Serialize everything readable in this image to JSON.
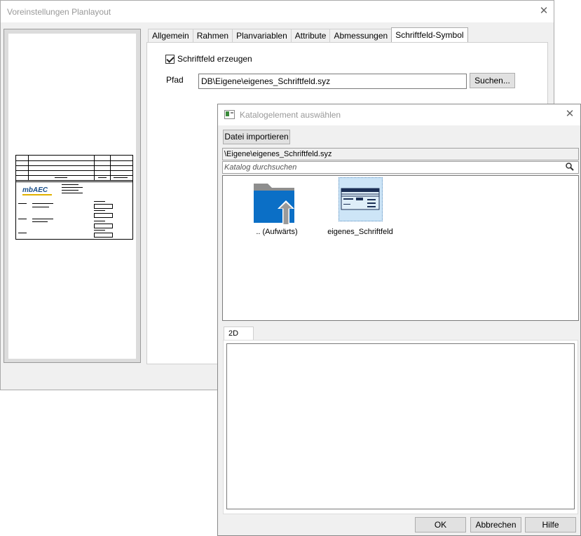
{
  "main_window": {
    "title": "Voreinstellungen Planlayout",
    "close_label": "✕",
    "tabs": [
      {
        "label": "Allgemein",
        "active": false
      },
      {
        "label": "Rahmen",
        "active": false
      },
      {
        "label": "Planvariablen",
        "active": false
      },
      {
        "label": "Attribute",
        "active": false
      },
      {
        "label": "Abmessungen",
        "active": false
      },
      {
        "label": "Schriftfeld-Symbol",
        "active": true
      }
    ],
    "checkbox_label": "Schriftfeld erzeugen",
    "checkbox_checked": true,
    "path_label": "Pfad",
    "path_value": "DB\\Eigene\\eigenes_Schriftfeld.syz",
    "search_button": "Suchen...",
    "preview_logo": "mbAEC"
  },
  "catalog_dialog": {
    "title": "Katalogelement auswählen",
    "close_label": "✕",
    "import_button": "Datei importieren",
    "current_path": "\\Eigene\\eigenes_Schriftfeld.syz",
    "search_placeholder": "Katalog durchsuchen",
    "items": [
      {
        "label": ".. (Aufwärts)",
        "icon": "folder-up-icon",
        "selected": false
      },
      {
        "label": "eigenes_Schriftfeld",
        "icon": "titleblock-thumbnail-icon",
        "selected": true
      }
    ],
    "preview_tab": "2D",
    "buttons": {
      "ok": "OK",
      "cancel": "Abbrechen",
      "help": "Hilfe"
    },
    "colors": {
      "folder": "#0b6fc6",
      "arrow": "#9a9a9a",
      "selection": "#cde5f7"
    }
  }
}
